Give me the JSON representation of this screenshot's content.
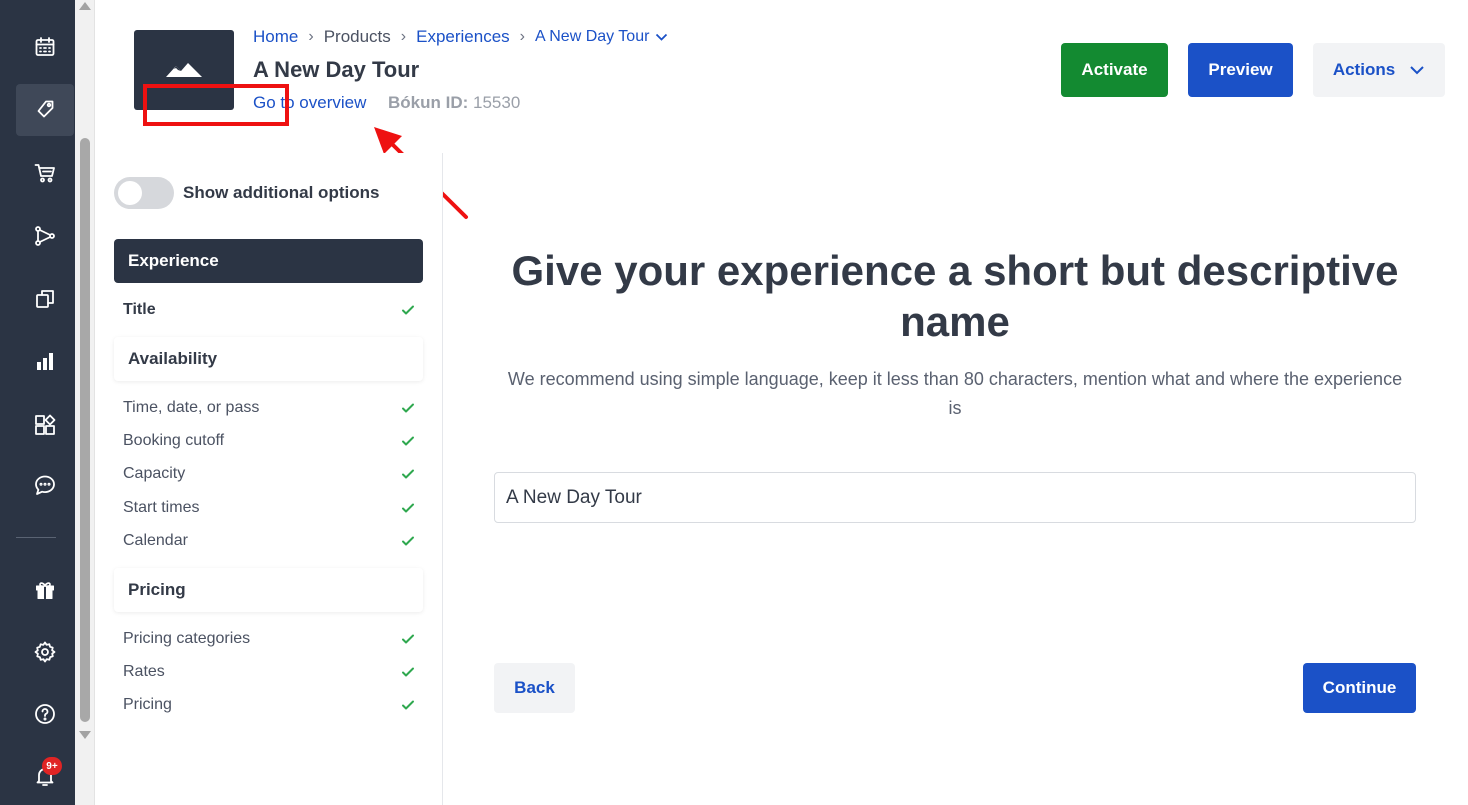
{
  "breadcrumb": {
    "home": "Home",
    "products": "Products",
    "experiences": "Experiences",
    "current": "A New Day Tour"
  },
  "product": {
    "title": "A New Day Tour",
    "goto_overview": "Go to overview",
    "id_label": "Bókun ID:",
    "id_value": "15530"
  },
  "toolbar": {
    "activate": "Activate",
    "preview": "Preview",
    "actions": "Actions"
  },
  "sidebar": {
    "toggle_label": "Show additional options",
    "sections": [
      {
        "label": "Experience",
        "items": [
          {
            "label": "Title"
          }
        ]
      },
      {
        "label": "Availability",
        "items": [
          {
            "label": "Time, date, or pass"
          },
          {
            "label": "Booking cutoff"
          },
          {
            "label": "Capacity"
          },
          {
            "label": "Start times"
          },
          {
            "label": "Calendar"
          }
        ]
      },
      {
        "label": "Pricing",
        "items": [
          {
            "label": "Pricing categories"
          },
          {
            "label": "Rates"
          },
          {
            "label": "Pricing"
          }
        ]
      }
    ]
  },
  "rail": {
    "notification_badge": "9+",
    "icons": [
      "calendar-icon",
      "tag-icon",
      "cart-icon",
      "network-icon",
      "copy-icon",
      "bar-chart-icon",
      "widgets-icon",
      "chat-icon",
      "gift-icon",
      "gear-icon",
      "help-icon",
      "bell-icon"
    ]
  },
  "main": {
    "heading": "Give your experience a short but descriptive name",
    "subtext": "We recommend using simple language, keep it less than 80 characters, mention what and where the experience is",
    "name_value": "A New Day Tour",
    "back": "Back",
    "continue": "Continue"
  },
  "colors": {
    "rail": "#2b3444",
    "primary": "#1b51c7",
    "success": "#138a31",
    "check": "#2fa84f",
    "annotation": "#ee1111"
  }
}
